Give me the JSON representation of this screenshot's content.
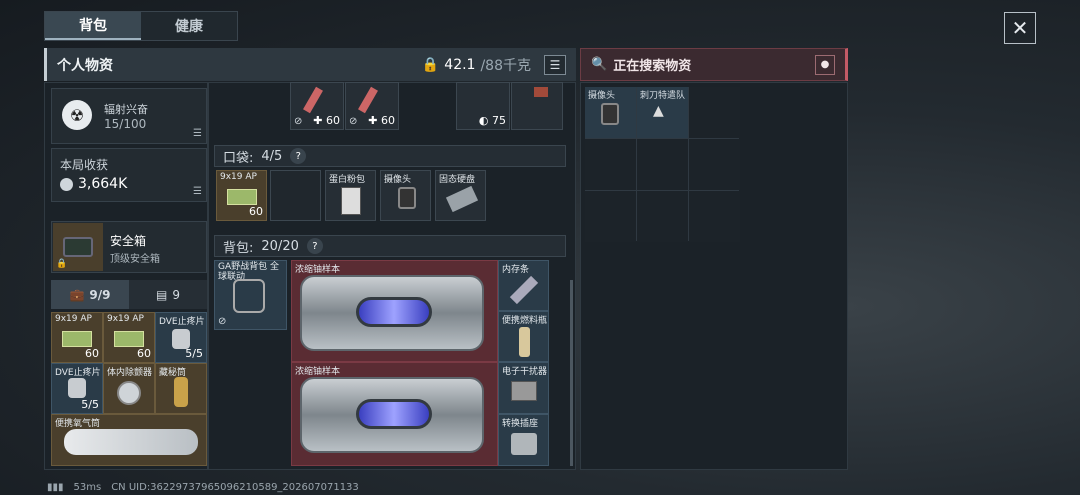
{
  "tabs": {
    "backpack": "背包",
    "health": "健康"
  },
  "header": {
    "title": "个人物资",
    "weight": "42.1",
    "weight_max": "/88千克"
  },
  "search": {
    "title": "正在搜索物资"
  },
  "stats": {
    "radiation_label": "辐射兴奋",
    "radiation_value": "15/100",
    "harvest_label": "本局收获",
    "harvest_value": "3,664K"
  },
  "safebox": {
    "title": "安全箱",
    "subtitle": "顶级安全箱"
  },
  "bag_tabs": {
    "count1": "9/9",
    "count2": "9"
  },
  "left_items": [
    {
      "name": "9x19 AP",
      "count": "60"
    },
    {
      "name": "9x19 AP",
      "count": "60"
    },
    {
      "name": "DVE止疼片",
      "count": "5/5"
    },
    {
      "name": "DVE止疼片",
      "count": "5/5"
    },
    {
      "name": "体内除颤器",
      "count": ""
    },
    {
      "name": "藏秘筒",
      "count": ""
    },
    {
      "name": "便携氧气筒",
      "count": ""
    }
  ],
  "top_items": {
    "c1": "60",
    "c2": "60",
    "c3": "75"
  },
  "pocket": {
    "label": "口袋:",
    "count": "4/5"
  },
  "pocket_items": [
    {
      "name": "9x19 AP",
      "count": "60"
    },
    {
      "name": "",
      "count": ""
    },
    {
      "name": "蛋白粉包",
      "count": ""
    },
    {
      "name": "摄像头",
      "count": ""
    },
    {
      "name": "固态硬盘",
      "count": ""
    }
  ],
  "backpack": {
    "label": "背包:",
    "count": "20/20"
  },
  "backpack_items": {
    "vest": "GA野战背包 全球联动",
    "sample1": "浓缩铀样本",
    "sample2": "浓缩铀样本",
    "memory": "内存条",
    "fuel": "便携燃料瓶",
    "jammer": "电子干扰器",
    "adapter": "转换插座"
  },
  "loot_items": {
    "camera": "摄像头",
    "squad": "刺刀特遣队"
  },
  "status": {
    "ping": "53ms",
    "uid": "CN UID:36229737965096210589_202607071133"
  }
}
